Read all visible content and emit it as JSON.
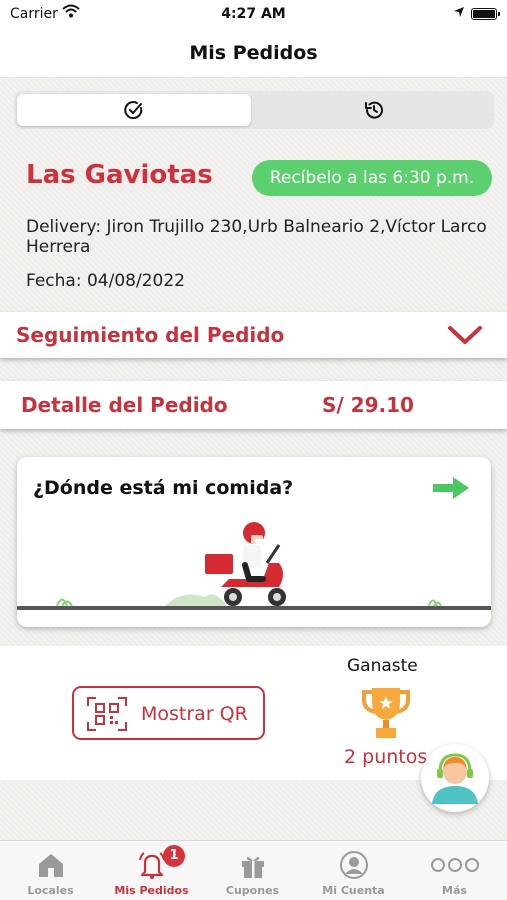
{
  "status_bar": {
    "carrier": "Carrier",
    "time": "4:27 AM"
  },
  "header": {
    "title": "Mis Pedidos"
  },
  "segments": [
    {
      "icon": "check-circle-icon",
      "selected": true
    },
    {
      "icon": "history-icon",
      "selected": false
    }
  ],
  "order": {
    "store_name": "Las Gaviotas",
    "eta": "Recíbelo a las 6:30 p.m.",
    "delivery": "Delivery: Jiron Trujillo 230,Urb Balneario 2,Víctor Larco Herrera",
    "date": "Fecha: 04/08/2022"
  },
  "tracking": {
    "label": "Seguimiento del Pedido",
    "icon": "chevron-down-icon"
  },
  "detail": {
    "label": "Detalle del Pedido",
    "amount": "S/ 29.10"
  },
  "track_card": {
    "question": "¿Dónde está mi comida?",
    "icon": "arrow-right-icon"
  },
  "qr": {
    "label": "Mostrar QR",
    "icon": "qr-code-icon"
  },
  "reward": {
    "label": "Ganaste",
    "points": "2 puntos",
    "icon": "trophy-icon"
  },
  "tabs": [
    {
      "label": "Locales",
      "icon": "store-icon",
      "active": false
    },
    {
      "label": "Mis Pedidos",
      "icon": "bell-icon",
      "active": true,
      "badge": "1"
    },
    {
      "label": "Cupones",
      "icon": "gift-icon",
      "active": false
    },
    {
      "label": "Mi Cuenta",
      "icon": "user-icon",
      "active": false
    },
    {
      "label": "Más",
      "icon": "more-icon",
      "active": false
    }
  ],
  "colors": {
    "brand_red": "#c8323d",
    "eta_green": "#5ccf6f",
    "arrow_green": "#4cc764"
  }
}
